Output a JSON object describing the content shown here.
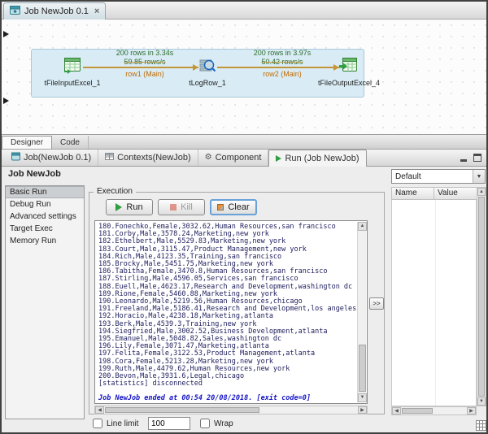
{
  "window": {
    "title_tab": "Job NewJob 0.1"
  },
  "colors": {
    "selection_fill": "#d9ecf5",
    "connection_line": "#c49538",
    "stats_text": "#2d6b2d",
    "row_label_text": "#c06a00",
    "console_text": "#20205e",
    "console_end_text": "#1414c8"
  },
  "canvas": {
    "components": [
      {
        "label": "tFileInputExcel_1"
      },
      {
        "label": "tLogRow_1"
      },
      {
        "label": "tFileOutputExcel_4"
      }
    ],
    "connections": [
      {
        "stats": "200 rows in 3.34s",
        "rate": "59.85 rows/s",
        "label": "row1 (Main)"
      },
      {
        "stats": "200 rows in 3.97s",
        "rate": "50.42 rows/s",
        "label": "row2 (Main)"
      }
    ]
  },
  "editor_tabs": {
    "designer": "Designer",
    "code": "Code"
  },
  "bottom_tabs": [
    {
      "label": "Job(NewJob 0.1)"
    },
    {
      "label": "Contexts(NewJob)"
    },
    {
      "label": "Component"
    },
    {
      "label": "Run (Job NewJob)"
    }
  ],
  "run_view": {
    "title": "Job NewJob",
    "nav": [
      {
        "label": "Basic Run"
      },
      {
        "label": "Debug Run"
      },
      {
        "label": "Advanced settings"
      },
      {
        "label": "Target Exec"
      },
      {
        "label": "Memory Run"
      }
    ],
    "execution": {
      "group_label": "Execution",
      "run_button": "Run",
      "kill_button": "Kill",
      "clear_button": "Clear",
      "console_lines": [
        "180.Fonechko,Female,3032.62,Human Resources,san francisco",
        "181.Corby,Male,3578.24,Marketing,new york",
        "182.Ethelbert,Male,5529.83,Marketing,new york",
        "183.Court,Male,3115.47,Product Management,new york",
        "184.Rich,Male,4123.35,Training,san francisco",
        "185.Brocky,Male,5451.75,Marketing,new york",
        "186.Tabitha,Female,3470.8,Human Resources,san francisco",
        "187.Stirling,Male,4596.05,Services,san francisco",
        "188.Euell,Male,4623.17,Research and Development,washington dc",
        "189.Rione,Female,5460.88,Marketing,new york",
        "190.Leonardo,Male,5219.56,Human Resources,chicago",
        "191.Freeland,Male,5186.41,Research and Development,los angeles",
        "192.Horacio,Male,4238.18,Marketing,atlanta",
        "193.Berk,Male,4539.3,Training,new york",
        "194.Siegfried,Male,3002.52,Business Development,atlanta",
        "195.Emanuel,Male,5048.82,Sales,washington dc",
        "196.Lily,Female,3071.47,Marketing,atlanta",
        "197.Felita,Female,3122.53,Product Management,atlanta",
        "198.Cora,Female,5213.28,Marketing,new york",
        "199.Ruth,Male,4479.62,Human Resources,new york",
        "200.Bevon,Male,3931.6,Legal,chicago",
        "[statistics] disconnected"
      ],
      "console_end_line": "Job NewJob ended at 00:54 20/08/2018. [exit code=0]"
    },
    "line_limit_label": "Line limit",
    "line_limit_value": "100",
    "wrap_label": "Wrap",
    "expand_button": ">>"
  },
  "right_panel": {
    "context_select": "Default",
    "columns": [
      "Name",
      "Value"
    ]
  }
}
